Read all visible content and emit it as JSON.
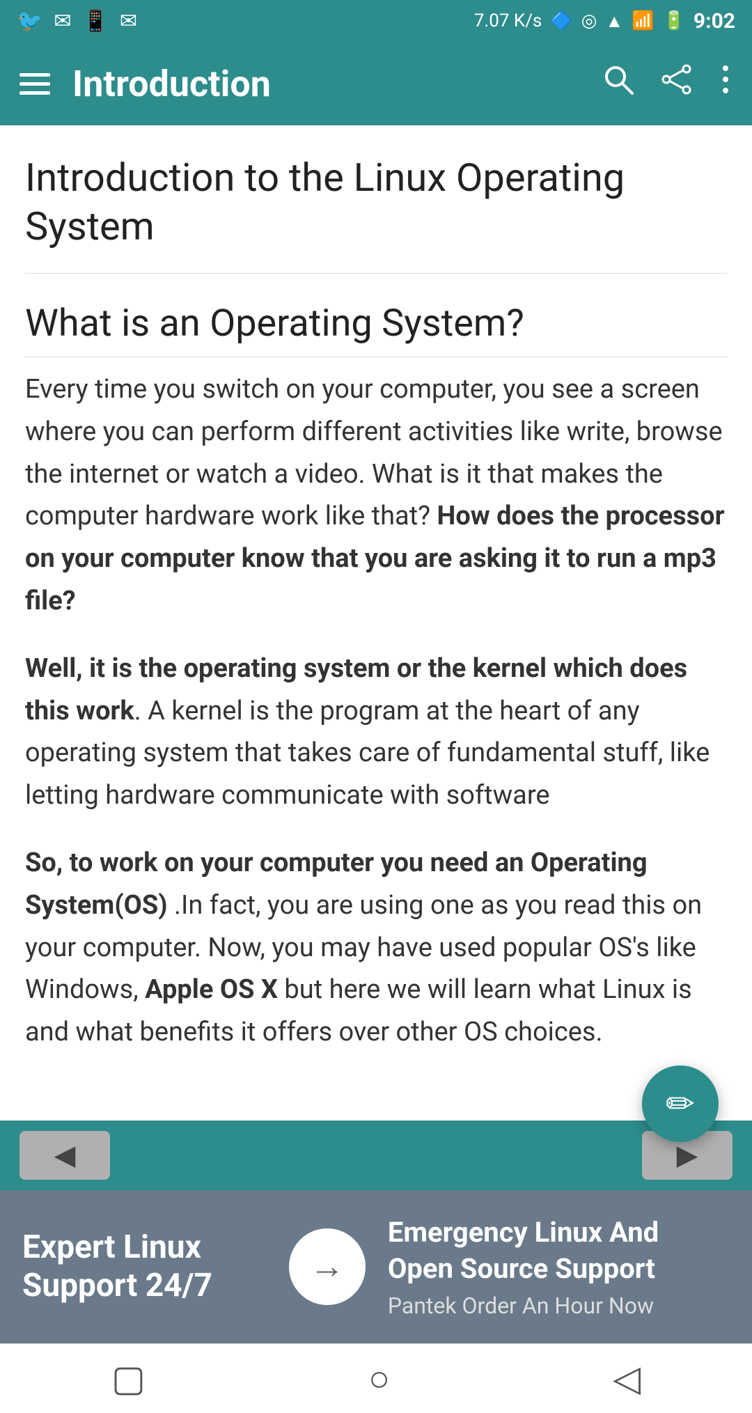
{
  "statusBar": {
    "left_icons": [
      "twitter",
      "mail",
      "phone",
      "mail2"
    ],
    "speed": "7.07 K/s",
    "right_icons": [
      "bluetooth",
      "media",
      "wifi",
      "signal",
      "battery"
    ],
    "time": "9:02"
  },
  "toolbar": {
    "menu_label": "Menu",
    "title": "Introduction",
    "search_label": "Search",
    "share_label": "Share",
    "more_label": "More options"
  },
  "article": {
    "title": "Introduction to the Linux Operating System",
    "section_heading": "What is an Operating System?",
    "paragraph1_normal": "Every time you switch on your computer, you see a screen where you can perform different activities like write, browse the internet or watch a video. What is it that makes the computer hardware work like that? ",
    "paragraph1_bold": "How does the processor on your computer know that you are asking it to run a mp3 file?",
    "paragraph2_bold": "Well, it is the operating system or the kernel which does this work",
    "paragraph2_normal": ". A kernel is the program at the heart of any operating system that takes care of fundamental stuff, like letting hardware communicate with software",
    "paragraph3_bold": "So, to work on your computer you need an Operating System(OS)",
    "paragraph3_normal": " .In fact,  you are using one as you read this on your computer. Now, you may have used popular OS's like Windows, ",
    "paragraph3_bold2": "Apple OS X",
    "paragraph3_end": " but here we will learn what Linux is and what benefits it offers over other OS choices."
  },
  "fab": {
    "label": "Edit",
    "icon": "✏"
  },
  "navigation": {
    "prev_label": "◀",
    "next_label": "▶"
  },
  "advertisement": {
    "headline": "Expert Linux Support 24/7",
    "arrow": "→",
    "right_title": "Emergency Linux And Open Source Support",
    "right_sub": "Pantek Order An Hour Now"
  },
  "bottomNav": {
    "square_icon": "▢",
    "circle_icon": "○",
    "back_icon": "◁"
  }
}
